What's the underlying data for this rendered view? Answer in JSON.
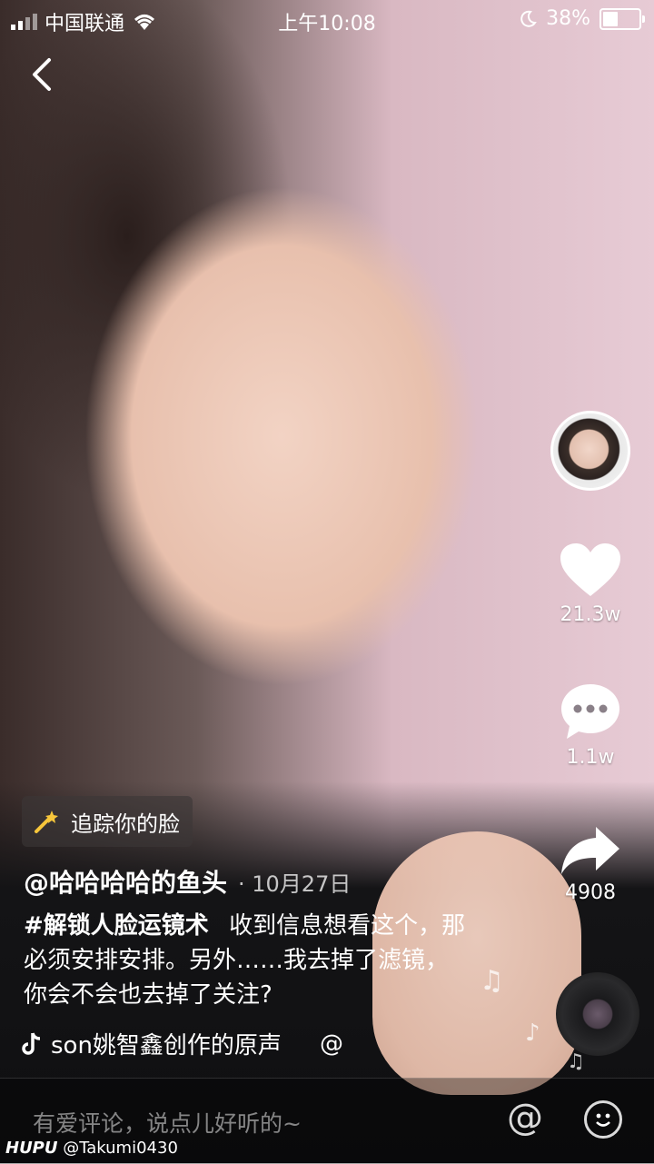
{
  "status_bar": {
    "carrier": "中国联通",
    "time": "上午10:08",
    "battery": "38%"
  },
  "video": {
    "effect_tag": "追踪你的脸",
    "author": "@哈哈哈哈的鱼头",
    "date": "· 10月27日",
    "hashtag": "#解锁人脸运镜术",
    "caption": "收到信息想看这个，那必须安排安排。另外……我去掉了滤镜，你会不会也去掉了关注?",
    "music": "son姚智鑫创作的原声",
    "music_at": "@"
  },
  "actions": {
    "likes": "21.3w",
    "comments": "1.1w",
    "shares": "4908"
  },
  "comment_bar": {
    "placeholder": "有爱评论，说点儿好听的~",
    "at_symbol": "@"
  },
  "watermark": {
    "brand": "HUPU",
    "handle": "@Takumi0430"
  },
  "icons": [
    "back-icon",
    "wifi-icon",
    "moon-icon",
    "heart-icon",
    "comment-icon",
    "share-icon",
    "wand-icon",
    "music-note-icon",
    "emoji-icon"
  ]
}
